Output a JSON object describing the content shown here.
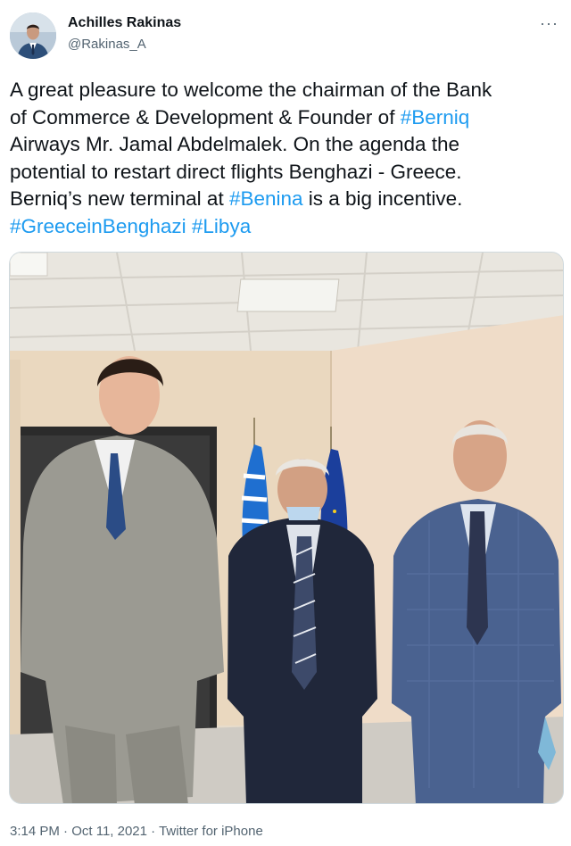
{
  "author": {
    "name": "Achilles Rakinas",
    "handle": "@Rakinas_A",
    "avatar_icon": "profile-photo"
  },
  "menu_icon": "more-dots-icon",
  "more_glyph": "···",
  "tweet": {
    "lines": [
      [
        {
          "t": "A great pleasure to welcome the chairman of the Bank"
        }
      ],
      [
        {
          "t": "of Commerce & Development & Founder of "
        },
        {
          "t": "#Berniq",
          "tag": true
        }
      ],
      [
        {
          "t": "Airways Mr. Jamal Abdelmalek. On the agenda the"
        }
      ],
      [
        {
          "t": "potential to restart direct flights Benghazi - Greece."
        }
      ],
      [
        {
          "t": "Berniq’s new terminal at "
        },
        {
          "t": "#Benina",
          "tag": true
        },
        {
          "t": " is a big incentive."
        }
      ],
      [
        {
          "t": "#GreeceinBenghazi",
          "tag": true
        },
        {
          "t": " "
        },
        {
          "t": "#Libya",
          "tag": true
        }
      ]
    ]
  },
  "photo": {
    "description_icon": "meeting-photo-image"
  },
  "meta": {
    "time": "3:14 PM",
    "separator": " · ",
    "date": "Oct 11, 2021",
    "source": "Twitter for iPhone"
  },
  "colors": {
    "link": "#1d9bf0",
    "text": "#0f1419",
    "secondary": "#536471"
  }
}
